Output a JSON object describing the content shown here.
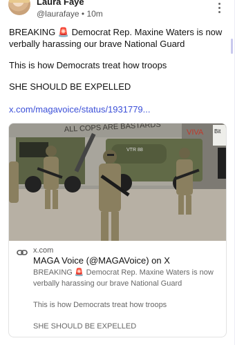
{
  "post": {
    "author_name": "Laura Faye",
    "handle": "@laurafaye",
    "separator": "•",
    "time": "10m",
    "text_lines": [
      "BREAKING 🚨 Democrat Rep. Maxine Waters is now verbally harassing our brave National Guard",
      "This is how Democrats treat how troops",
      "SHE SHOULD BE EXPELLED"
    ],
    "link": "x.com/magavoice/status/1931779..."
  },
  "link_card": {
    "domain": "x.com",
    "title": "MAGA Voice (@MAGAVoice) on X",
    "description_lines": [
      "BREAKING 🚨 Democrat Rep. Maxine Waters is now verbally harassing our brave National Guard",
      "This is how Democrats treat how troops",
      "SHE SHOULD BE EXPELLED"
    ],
    "image_graffiti": "ALL COPS ARE BASTARDS",
    "image_graffiti_right": "VIVA",
    "image_sign": "Bit",
    "image_truck_label": "VTR 88"
  },
  "icons": {
    "more": "more-vertical-icon",
    "link": "link-icon"
  },
  "colors": {
    "link": "#3b4fd8",
    "muted": "#666666",
    "border": "#e2e2e2"
  }
}
